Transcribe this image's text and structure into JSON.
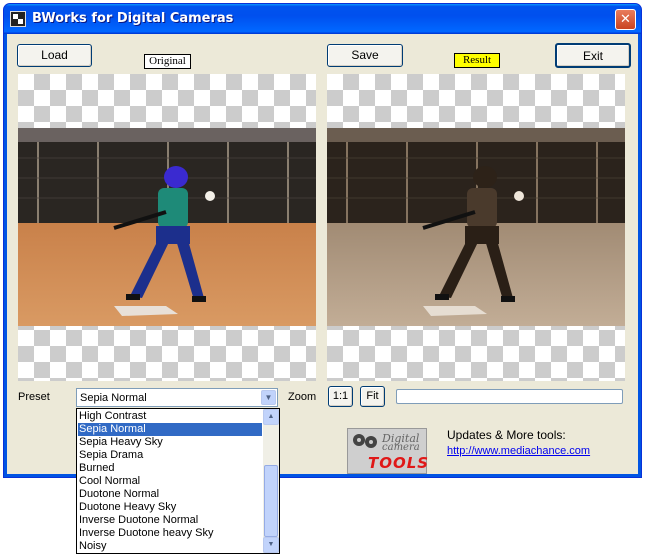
{
  "window": {
    "title": "BWorks for Digital Cameras",
    "close_label": "✕"
  },
  "toolbar": {
    "load_label": "Load",
    "save_label": "Save",
    "exit_label": "Exit"
  },
  "tags": {
    "original": "Original",
    "result": "Result"
  },
  "preset": {
    "label": "Preset",
    "selected": "Sepia Normal",
    "options": [
      "High Contrast",
      "Sepia Normal",
      "Sepia Heavy Sky",
      "Sepia Drama",
      "Burned",
      "Cool Normal",
      "Duotone Normal",
      "Duotone Heavy Sky",
      "Inverse Duotone Normal",
      "Inverse Duotone heavy Sky",
      "Noisy"
    ]
  },
  "zoom": {
    "label": "Zoom",
    "one_to_one_label": "1:1",
    "fit_label": "Fit"
  },
  "progress": {
    "value": 0
  },
  "logo": {
    "line1": "Digital",
    "line2": "camera",
    "line3": "TOOLS"
  },
  "updates": {
    "label": "Updates & More tools:",
    "link": "http://www.mediachance.com"
  },
  "colors": {
    "titlebar": "#0054e3",
    "client": "#ece9d8",
    "selection": "#316ac5",
    "result_tag_bg": "#ffff00",
    "logo_text": "#e01818"
  },
  "icons": {
    "app": "app-icon",
    "close": "close-icon",
    "dropdown": "chevron-down-icon",
    "scroll_up": "scroll-up-icon",
    "scroll_down": "scroll-down-icon"
  }
}
